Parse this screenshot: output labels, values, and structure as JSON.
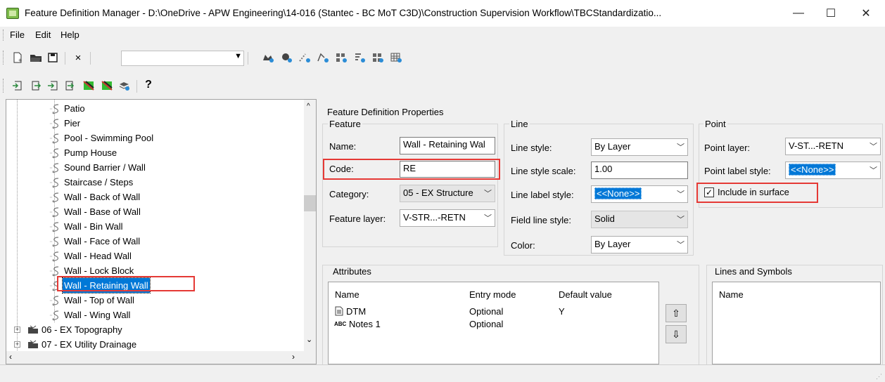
{
  "window": {
    "title": "Feature Definition Manager - D:\\OneDrive - APW Engineering\\14-016 (Stantec - BC MoT C3D)\\Construction Supervision Workflow\\TBCStandardizatio...",
    "minimize": "—",
    "maximize": "☐",
    "close": "✕"
  },
  "menu": [
    "File",
    "Edit",
    "Help"
  ],
  "toolbar": {
    "dropdown_value": "",
    "help": "?"
  },
  "tree": {
    "features": [
      "Patio",
      "Pier",
      "Pool - Swimming Pool",
      "Pump House",
      "Sound Barrier / Wall",
      "Staircase / Steps",
      "Wall - Back of Wall",
      "Wall - Base of Wall",
      "Wall - Bin Wall",
      "Wall - Face of Wall",
      "Wall - Head Wall",
      "Wall - Lock Block",
      "Wall - Retaining Wall",
      "Wall - Top of Wall",
      "Wall - Wing Wall"
    ],
    "selected_index": 12,
    "categories": [
      "06 - EX Topography",
      "07 - EX Utility Drainage"
    ]
  },
  "props": {
    "title": "Feature Definition Properties",
    "feature": {
      "label": "Feature",
      "name_label": "Name:",
      "name_value": "Wall - Retaining Wal",
      "code_label": "Code:",
      "code_value": "RE",
      "category_label": "Category:",
      "category_value": "05 - EX Structure",
      "layer_label": "Feature layer:",
      "layer_value": "V-STR...-RETN"
    },
    "line": {
      "label": "Line",
      "style_label": "Line style:",
      "style_value": "By Layer",
      "scale_label": "Line style scale:",
      "scale_value": "1.00",
      "label_style_label": "Line label style:",
      "label_style_value": "<<None>>",
      "field_label": "Field line style:",
      "field_value": "Solid",
      "color_label": "Color:",
      "color_value": "By Layer"
    },
    "point": {
      "label": "Point",
      "layer_label": "Point layer:",
      "layer_value": "V-ST...-RETN",
      "label_style_label": "Point label style:",
      "label_style_value": "<<None>>",
      "include_label": "Include in surface",
      "include_checked": true
    }
  },
  "attributes": {
    "title": "Attributes",
    "headers": [
      "Name",
      "Entry mode",
      "Default value"
    ],
    "rows": [
      {
        "icon": "dtm-icon",
        "name": "DTM",
        "mode": "Optional",
        "default": "Y"
      },
      {
        "icon": "abc-text-icon",
        "name": "Notes 1",
        "mode": "Optional",
        "default": ""
      }
    ]
  },
  "lines_symbols": {
    "title": "Lines and Symbols",
    "header": "Name"
  },
  "colors": {
    "accent": "#0078d7",
    "highlight_box": "#e53935"
  }
}
